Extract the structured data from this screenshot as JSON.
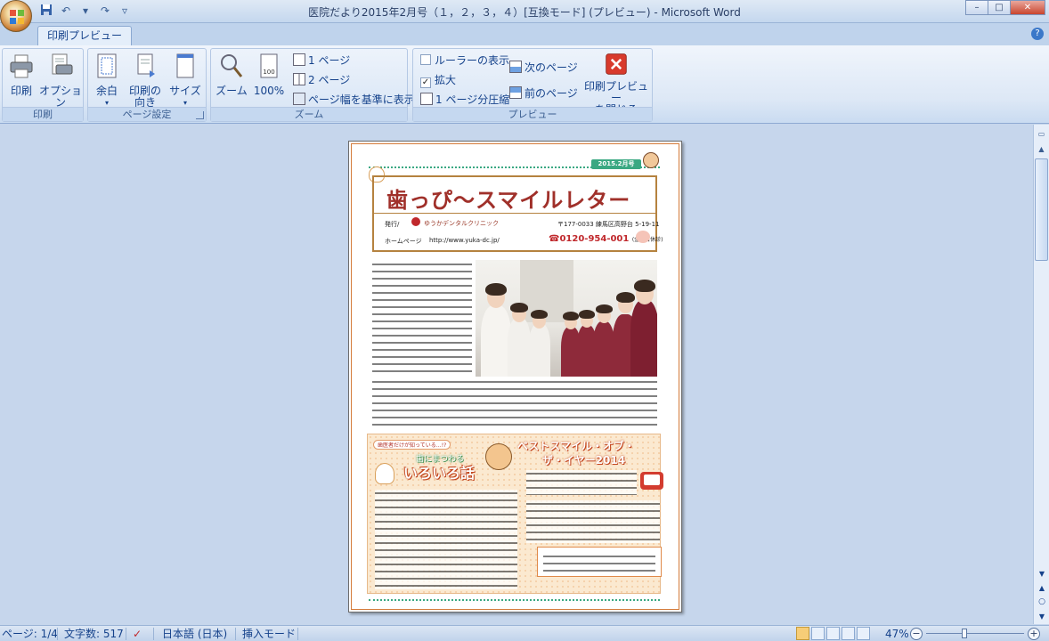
{
  "window": {
    "title": "医院だより2015年2月号（１，２，３，４）[互換モード] (プレビュー) - Microsoft Word",
    "minimize": "–",
    "maximize": "□",
    "close": "✕"
  },
  "qat": {
    "save_icon": "save-icon",
    "undo_icon": "undo-icon",
    "redo_icon": "redo-icon",
    "customize_icon": "dropdown-icon"
  },
  "tab": {
    "label": "印刷プレビュー",
    "help": "?"
  },
  "ribbon": {
    "print_group": {
      "label": "印刷",
      "print_label": "印刷",
      "options_label": "オプション"
    },
    "page_setup_group": {
      "label": "ページ設定",
      "margins_label": "余白",
      "orientation_label_1": "印刷の",
      "orientation_label_2": "向き",
      "size_label": "サイズ"
    },
    "zoom_group": {
      "label": "ズーム",
      "zoom_label": "ズーム",
      "hundred_label": "100%",
      "one_page": "1 ページ",
      "two_pages": "2 ページ",
      "page_width": "ページ幅を基準に表示"
    },
    "preview_group": {
      "label": "プレビュー",
      "show_ruler": "ルーラーの表示",
      "magnifier": "拡大",
      "shrink_one_page": "1 ページ分圧縮",
      "next_page": "次のページ",
      "prev_page": "前のページ",
      "close_label_1": "印刷プレビュー",
      "close_label_2": "を閉じる",
      "magnifier_checked": true,
      "ruler_checked": false
    }
  },
  "page": {
    "date_badge": "2015.2月号",
    "title": "歯っぴ～スマイルレター",
    "publisher": "発行/",
    "clinic_name": "ゆうかデンタルクリニック",
    "address": "〒177-0033 練馬区高野台 5-19-11",
    "homepage_label": "ホームページ",
    "homepage_url": "http://www.yuka-dc.jp/",
    "phone": "☎0120-954-001",
    "phone_note": "(金曜日休診)",
    "special_badge": "歯医者だけが知っている…!?",
    "special_head1": "歯にまつわる",
    "special_head2": "いろいろ話",
    "special_title1": "ベストスマイル・オブ・",
    "special_title2": "ザ・イヤー2014"
  },
  "status": {
    "page": "ページ: 1/4",
    "words": "文字数: 517",
    "language": "日本語 (日本)",
    "mode": "挿入モード",
    "zoom": "47%",
    "zoom_fraction": 0.47
  }
}
